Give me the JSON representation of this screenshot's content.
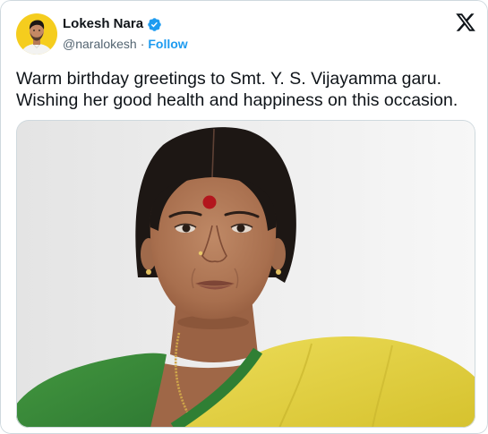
{
  "post": {
    "author": {
      "name": "Lokesh Nara",
      "handle": "@naralokesh",
      "verified": true
    },
    "separator": "·",
    "follow_label": "Follow",
    "text": "Warm birthday greetings to Smt. Y. S. Vijayamma garu. Wishing her good health and happiness on this occasion."
  },
  "icons": {
    "verified": "verified-badge-icon",
    "platform": "x-logo-icon"
  },
  "colors": {
    "text": "#0f1419",
    "secondary_text": "#536471",
    "follow": "#1d9bf0",
    "verified_badge": "#1d9bf0",
    "border": "#cfd9de",
    "avatar_background": "#f5cd1e"
  }
}
